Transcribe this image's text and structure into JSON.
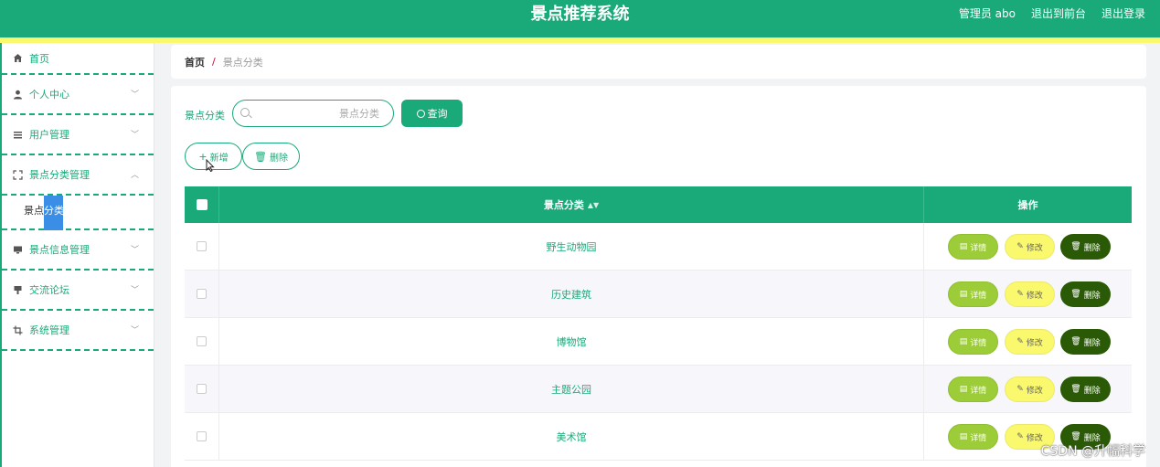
{
  "header": {
    "title": "景点推荐系统",
    "user": "管理员 abo",
    "to_front": "退出到前台",
    "logout": "退出登录"
  },
  "sidebar": {
    "items": [
      {
        "label": "首页",
        "icon": "home-icon"
      },
      {
        "label": "个人中心",
        "icon": "user-icon"
      },
      {
        "label": "用户管理",
        "icon": "list-icon"
      },
      {
        "label": "景点分类管理",
        "icon": "fullscreen-icon"
      },
      {
        "label": "景点信息管理",
        "icon": "monitor-icon"
      },
      {
        "label": "交流论坛",
        "icon": "forum-icon"
      },
      {
        "label": "系统管理",
        "icon": "crop-icon"
      }
    ],
    "submenu": {
      "prefix": "景点",
      "highlight": "分类"
    }
  },
  "breadcrumb": {
    "home": "首页",
    "separator": "/",
    "current": "景点分类"
  },
  "search": {
    "label": "景点分类",
    "placeholder": "景点分类",
    "button": "查询"
  },
  "actions": {
    "add": "新增",
    "delete": "删除"
  },
  "table": {
    "columns": [
      "景点分类",
      "操作"
    ],
    "rows": [
      {
        "name": "野生动物园"
      },
      {
        "name": "历史建筑"
      },
      {
        "name": "博物馆"
      },
      {
        "name": "主题公园"
      },
      {
        "name": "美术馆"
      }
    ],
    "row_actions": {
      "detail": "详情",
      "edit": "修改",
      "delete": "删除"
    }
  },
  "watermark": "CSDN @升幅科学",
  "colors": {
    "primary": "#1aa979",
    "accent_yellow": "#faf86d",
    "detail": "#9ccc38",
    "delete": "#2a5a06"
  }
}
